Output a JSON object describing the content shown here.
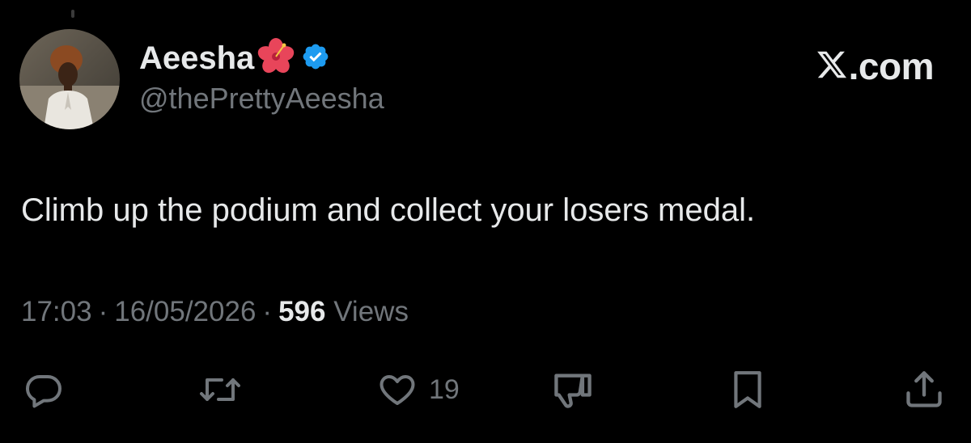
{
  "tweet": {
    "author": {
      "display_name": "Aeesha",
      "handle": "@thePrettyAeesha",
      "avatar_icon": "profile-photo",
      "name_emoji_icon": "hibiscus-icon",
      "verified_icon": "verified-badge-icon"
    },
    "brand": {
      "logo_icon": "x-logo-icon",
      "suffix": ".com"
    },
    "text": "Climb up the podium and collect your losers medal.",
    "meta": {
      "time": "17:03",
      "date": "16/05/2026",
      "separator": "·",
      "views_count": "596",
      "views_label": "Views"
    },
    "actions": {
      "reply_icon": "reply-icon",
      "repost_icon": "repost-icon",
      "like_icon": "heart-icon",
      "like_count": "19",
      "dislike_icon": "thumbs-down-icon",
      "bookmark_icon": "bookmark-icon",
      "share_icon": "share-icon"
    }
  },
  "colors": {
    "background": "#000000",
    "primary_text": "#e7e9ea",
    "secondary_text": "#71767b",
    "verified_blue": "#1d9bf0",
    "hibiscus_red": "#e8455a"
  }
}
